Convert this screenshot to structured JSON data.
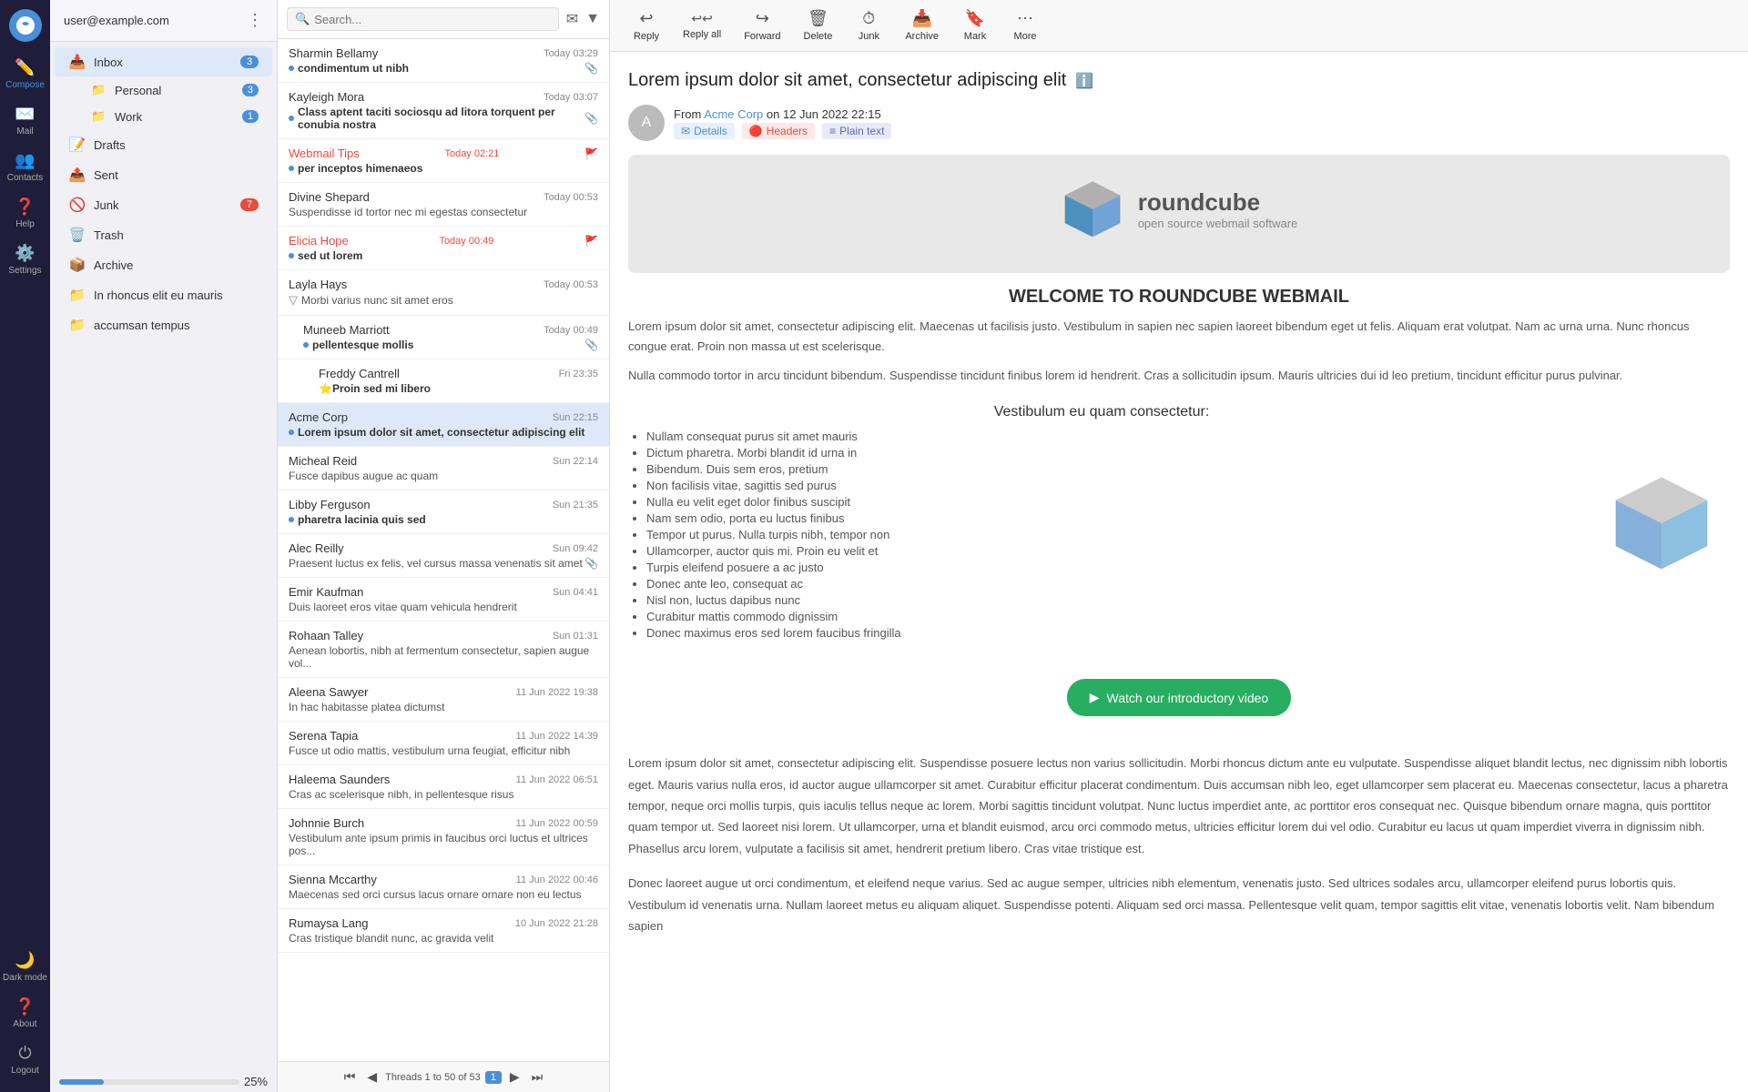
{
  "sidebar": {
    "logo_alt": "Roundcube",
    "items": [
      {
        "id": "compose",
        "label": "Compose",
        "icon": "✏️",
        "active": true
      },
      {
        "id": "mail",
        "label": "Mail",
        "icon": "✉️"
      },
      {
        "id": "contacts",
        "label": "Contacts",
        "icon": "👥"
      },
      {
        "id": "help",
        "label": "Help",
        "icon": "❓"
      },
      {
        "id": "settings",
        "label": "Settings",
        "icon": "⚙️"
      }
    ],
    "bottom_items": [
      {
        "id": "dark_mode",
        "label": "Dark mode",
        "icon": "🌙"
      },
      {
        "id": "about",
        "label": "About",
        "icon": "❓"
      },
      {
        "id": "logout",
        "label": "Logout",
        "icon": "⏻"
      }
    ]
  },
  "nav": {
    "user_email": "user@example.com",
    "more_icon": "⋮",
    "items": [
      {
        "id": "inbox",
        "label": "Inbox",
        "icon": "📥",
        "badge": "3",
        "active": true,
        "expanded": true
      },
      {
        "id": "personal",
        "label": "Personal",
        "icon": "📁",
        "badge": "3",
        "sub": true
      },
      {
        "id": "work",
        "label": "Work",
        "icon": "📁",
        "badge": "1",
        "sub": true
      },
      {
        "id": "drafts",
        "label": "Drafts",
        "icon": "📝"
      },
      {
        "id": "sent",
        "label": "Sent",
        "icon": "📤"
      },
      {
        "id": "junk",
        "label": "Junk",
        "icon": "🚫",
        "badge": "7"
      },
      {
        "id": "trash",
        "label": "Trash",
        "icon": "🗑️"
      },
      {
        "id": "archive",
        "label": "Archive",
        "icon": "📦"
      },
      {
        "id": "rhoncus",
        "label": "In rhoncus elit eu mauris",
        "icon": "📁"
      },
      {
        "id": "accumsan",
        "label": "accumsan tempus",
        "icon": "📁"
      }
    ]
  },
  "email_list": {
    "search_placeholder": "Search...",
    "emails": [
      {
        "id": 1,
        "sender": "Sharmin Bellamy",
        "date": "Today 03:29",
        "subject": "condimentum ut nibh",
        "unread": true,
        "attach": true,
        "date_today": false
      },
      {
        "id": 2,
        "sender": "Kayleigh Mora",
        "date": "Today 03:07",
        "subject": "Class aptent taciti sociosqu ad litora torquent per conubia nostra",
        "unread": true,
        "attach": true,
        "date_today": false
      },
      {
        "id": 3,
        "sender": "Webmail Tips",
        "date": "Today 02:21",
        "subject": "per inceptos himenaeos",
        "unread": true,
        "flag": true,
        "date_today": true,
        "sender_red": true
      },
      {
        "id": 4,
        "sender": "Divine Shepard",
        "date": "Today 00:53",
        "subject": "Suspendisse id tortor nec mi egestas consectetur",
        "unread": false,
        "date_today": false
      },
      {
        "id": 5,
        "sender": "Elicia Hope",
        "date": "Today 00:49",
        "subject": "sed ut lorem",
        "unread": true,
        "flag": true,
        "date_today": true,
        "sender_red": true
      },
      {
        "id": 6,
        "sender": "Layla Hays",
        "date": "Today 00:53",
        "subject": "Morbi varius nunc sit amet eros",
        "unread": false,
        "date_today": false,
        "thread": true
      },
      {
        "id": 7,
        "sender": "Muneeb Marriott",
        "date": "Today 00:49",
        "subject": "pellentesque mollis",
        "unread": true,
        "attach": true,
        "date_today": false,
        "indent": 1
      },
      {
        "id": 8,
        "sender": "Freddy Cantrell",
        "date": "Fri 23:35",
        "subject": "Proin sed mi libero",
        "unread": false,
        "starred": true,
        "date_today": false,
        "indent": 2
      },
      {
        "id": 9,
        "sender": "Acme Corp",
        "date": "Sun 22:15",
        "subject": "Lorem ipsum dolor sit amet, consectetur adipiscing elit",
        "unread": true,
        "date_today": false,
        "active": true
      },
      {
        "id": 10,
        "sender": "Micheal Reid",
        "date": "Sun 22:14",
        "subject": "Fusce dapibus augue ac quam",
        "unread": false,
        "date_today": false
      },
      {
        "id": 11,
        "sender": "Libby Ferguson",
        "date": "Sun 21:35",
        "subject": "pharetra lacinia quis sed",
        "unread": true,
        "date_today": false
      },
      {
        "id": 12,
        "sender": "Alec Reilly",
        "date": "Sun 09:42",
        "subject": "Praesent luctus ex felis, vel cursus massa venenatis sit amet",
        "unread": false,
        "attach": true,
        "date_today": false
      },
      {
        "id": 13,
        "sender": "Emir Kaufman",
        "date": "Sun 04:41",
        "subject": "Duis laoreet eros vitae quam vehicula hendrerit",
        "unread": false,
        "date_today": false
      },
      {
        "id": 14,
        "sender": "Rohaan Talley",
        "date": "Sun 01:31",
        "subject": "Aenean lobortis, nibh at fermentum consectetur, sapien augue vol...",
        "unread": false,
        "date_today": false
      },
      {
        "id": 15,
        "sender": "Aleena Sawyer",
        "date": "11 Jun 2022 19:38",
        "subject": "In hac habitasse platea dictumst",
        "unread": false,
        "date_today": false
      },
      {
        "id": 16,
        "sender": "Serena Tapia",
        "date": "11 Jun 2022 14:39",
        "subject": "Fusce ut odio mattis, vestibulum urna feugiat, efficitur nibh",
        "unread": false,
        "date_today": false
      },
      {
        "id": 17,
        "sender": "Haleema Saunders",
        "date": "11 Jun 2022 06:51",
        "subject": "Cras ac scelerisque nibh, in pellentesque risus",
        "unread": false,
        "date_today": false
      },
      {
        "id": 18,
        "sender": "Johnnie Burch",
        "date": "11 Jun 2022 00:59",
        "subject": "Vestibulum ante ipsum primis in faucibus orci luctus et ultrices pos...",
        "unread": false,
        "date_today": false
      },
      {
        "id": 19,
        "sender": "Sienna Mccarthy",
        "date": "11 Jun 2022 00:46",
        "subject": "Maecenas sed orci cursus lacus ornare ornare non eu lectus",
        "unread": false,
        "date_today": false
      },
      {
        "id": 20,
        "sender": "Rumaysa Lang",
        "date": "10 Jun 2022 21:28",
        "subject": "Cras tristique blandit nunc, ac gravida velit",
        "unread": false,
        "date_today": false
      }
    ],
    "footer": {
      "threads_label": "Threads 1 to 50 of 53",
      "current_page": "1"
    },
    "progress": "25%"
  },
  "toolbar": {
    "buttons": [
      {
        "id": "reply",
        "label": "Reply",
        "icon": "↩"
      },
      {
        "id": "reply_all",
        "label": "Reply all",
        "icon": "↩↩"
      },
      {
        "id": "forward",
        "label": "Forward",
        "icon": "↪"
      },
      {
        "id": "delete",
        "label": "Delete",
        "icon": "🗑"
      },
      {
        "id": "junk",
        "label": "Junk",
        "icon": "⏱"
      },
      {
        "id": "archive",
        "label": "Archive",
        "icon": "📦"
      },
      {
        "id": "mark",
        "label": "Mark",
        "icon": "🔖"
      },
      {
        "id": "more",
        "label": "More",
        "icon": "⋯"
      }
    ]
  },
  "email_view": {
    "subject": "Lorem ipsum dolor sit amet, consectetur adipiscing elit",
    "from_label": "From",
    "from_name": "Acme Corp",
    "from_date": "on 12 Jun 2022 22:15",
    "tags": [
      {
        "label": "Details",
        "type": "details"
      },
      {
        "label": "Headers",
        "type": "headers"
      },
      {
        "label": "Plain text",
        "type": "plain"
      }
    ],
    "logo_text": "roundcube",
    "logo_sub": "open source webmail software",
    "welcome_title": "WELCOME TO ROUNDCUBE WEBMAIL",
    "body_para1": "Lorem ipsum dolor sit amet, consectetur adipiscing elit. Maecenas ut facilisis justo. Vestibulum in sapien nec sapien laoreet bibendum eget ut felis. Aliquam erat volutpat. Nam ac urna urna. Nunc rhoncus congue erat. Proin non massa ut est scelerisque.",
    "body_para2": "Nulla commodo tortor in arcu tincidunt bibendum. Suspendisse tincidunt finibus lorem id hendrerit. Cras a sollicitudin ipsum. Mauris ultricies dui id leo pretium, tincidunt efficitur purus pulvinar.",
    "vestibulum_title": "Vestibulum eu quam consectetur:",
    "list_items": [
      "Nullam consequat purus sit amet mauris",
      "Dictum pharetra. Morbi blandit id urna in",
      "Bibendum. Duis sem eros, pretium",
      "Non facilisis vitae, sagittis sed purus",
      "Nulla eu velit eget dolor finibus suscipit",
      "Nam sem odio, porta eu luctus finibus",
      "Tempor ut purus. Nulla turpis nibh, tempor non",
      "Ullamcorper, auctor quis mi. Proin eu velit et",
      "Turpis eleifend posuere a ac justo",
      "Donec ante leo, consequat ac",
      "Nisl non, luctus dapibus nunc",
      "Curabitur mattis commodo dignissim",
      "Donec maximus eros sed lorem faucibus fringilla"
    ],
    "watch_video_label": "Watch our introductory video",
    "body_long1": "Lorem ipsum dolor sit amet, consectetur adipiscing elit. Suspendisse posuere lectus non varius sollicitudin. Morbi rhoncus dictum ante eu vulputate. Suspendisse aliquet blandit lectus, nec dignissim nibh lobortis eget. Mauris varius nulla eros, id auctor augue ullamcorper sit amet. Curabitur efficitur placerat condimentum. Duis accumsan nibh leo, eget ullamcorper sem placerat eu. Maecenas consectetur, lacus a pharetra tempor, neque orci mollis turpis, quis iaculis tellus neque ac lorem. Morbi sagittis tincidunt volutpat. Nunc luctus imperdiet ante, ac porttitor eros consequat nec. Quisque bibendum ornare magna, quis porttitor quam tempor ut. Sed laoreet nisi lorem. Ut ullamcorper, urna et blandit euismod, arcu orci commodo metus, ultricies efficitur lorem dui vel odio. Curabitur eu lacus ut quam imperdiet viverra in dignissim nibh. Phasellus arcu lorem, vulputate a facilisis sit amet, hendrerit pretium libero. Cras vitae tristique est.",
    "body_long2": "Donec laoreet augue ut orci condimentum, et eleifend neque varius. Sed ac augue semper, ultricies nibh elementum, venenatis justo. Sed ultrices sodales arcu, ullamcorper eleifend purus lobortis quis. Vestibulum id venenatis urna. Nullam laoreet metus eu aliquam aliquet. Suspendisse potenti. Aliquam sed orci massa. Pellentesque velit quam, tempor sagittis elit vitae, venenatis lobortis velit. Nam bibendum sapien"
  }
}
